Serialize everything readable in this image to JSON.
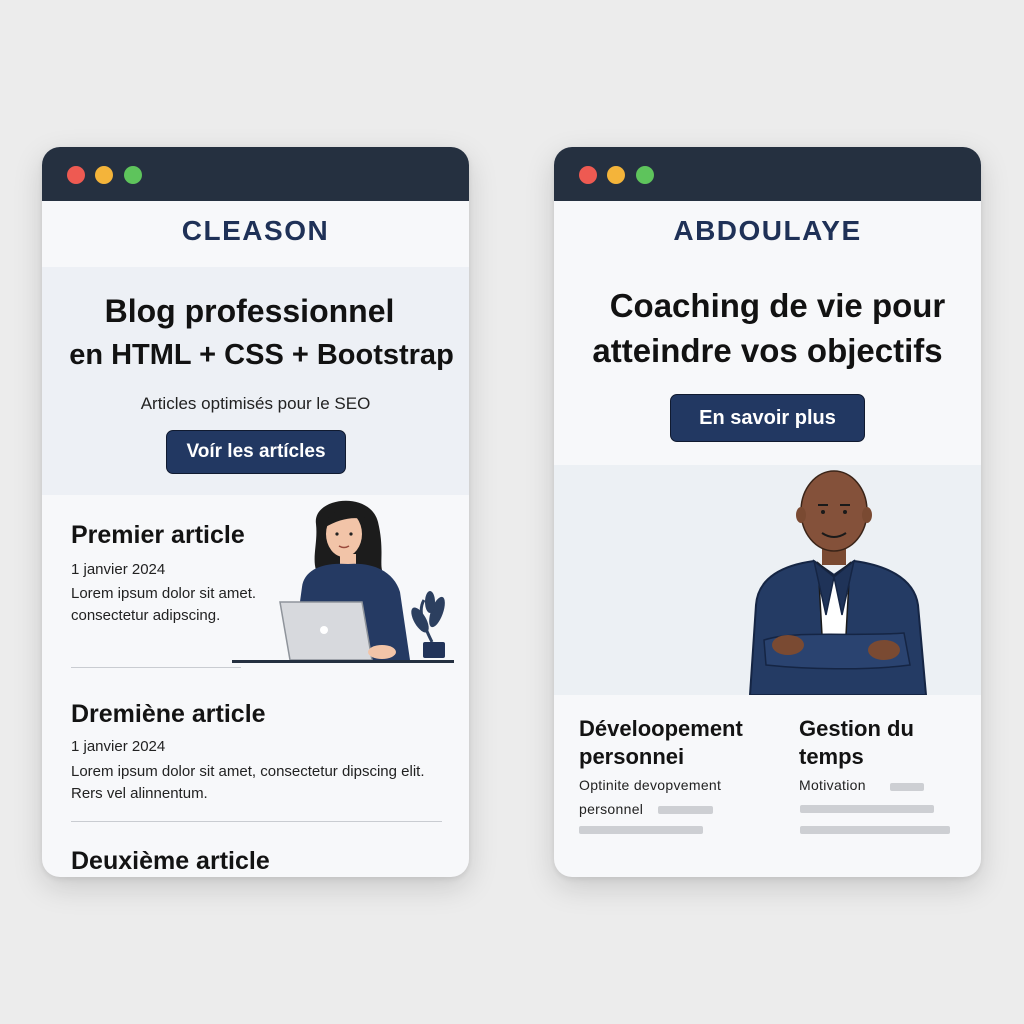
{
  "colors": {
    "background": "#ececec",
    "titlebar": "#253040",
    "dot_red": "#ee5a52",
    "dot_yellow": "#f4b43a",
    "dot_green": "#5ec45c",
    "brand": "#1f3157",
    "button": "#223862",
    "hero_bg": "#edf0f5"
  },
  "left_window": {
    "brand": "CLEASON",
    "hero": {
      "title_line1": "Blog professionnel",
      "title_line2": "en HTML + CSS + Bootstrap",
      "subtitle": "Articles optimisés pour le SEO",
      "button_label": "Voír les artícles"
    },
    "articles": [
      {
        "title": "Premier article",
        "date": "1 janvier 2024",
        "body_line1": "Lorem ipsum dolor sit amet.",
        "body_line2": "consectetur adipscing."
      },
      {
        "title": "Dremiène article",
        "date": "1 janvier 2024",
        "body_line1": "Lorem ipsum dolor sit amet, consectetur  dipscing elit.",
        "body_line2": "Rers vel alinnentum."
      },
      {
        "title": "Deuxième article"
      }
    ],
    "illustration_icon": "woman-laptop-illustration"
  },
  "right_window": {
    "brand": "ABDOULAYE",
    "hero": {
      "title_line1": "Coaching de vie pour",
      "title_line2": "atteindre vos objectifs",
      "button_label": "En savoir plus"
    },
    "illustration_icon": "coach-man-illustration",
    "features": [
      {
        "title_line1": "Déveloopement",
        "title_line2": "personnei",
        "text_line1": "Optinite devopvement",
        "text_line2": "personnel"
      },
      {
        "title_line1": "Gestion du",
        "title_line2": "temps",
        "text_line1": "Motivation"
      }
    ]
  }
}
